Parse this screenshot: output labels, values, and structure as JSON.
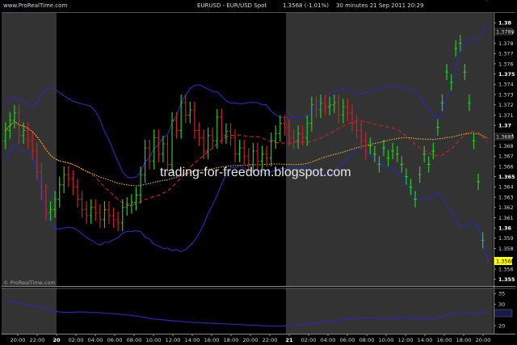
{
  "header": {
    "brand": "www.ProRealTime.com",
    "instrument": "EURUSD - EUR/USD Spot",
    "last_change": "1.3568 (-1.01%)",
    "period": "30 minutes  21 Sep 2011 20:29"
  },
  "watermark": "trading-for-freedom.blogspot.com",
  "footer_brand": "© ProRealTime.com",
  "colors": {
    "background": "#000000",
    "session_shade": "#333333",
    "up_candle": "#22cc22",
    "down_candle": "#cc2222",
    "bollinger": "#2828b4",
    "sma_dashed": "#cc2222",
    "sma_dotted": "#e8c020",
    "indicator": "#2828b4",
    "price_box": "#ffff00"
  },
  "chart_data": [
    {
      "type": "candlestick",
      "title": "EURUSD - EUR/USD Spot",
      "x_ticks": [
        "20:00",
        "22:00",
        "20",
        "02:00",
        "04:00",
        "06:00",
        "08:00",
        "10:00",
        "12:00",
        "14:00",
        "16:00",
        "18:00",
        "20:00",
        "22:00",
        "21",
        "02:00",
        "04:00",
        "06:00",
        "08:00",
        "10:00",
        "12:00",
        "14:00",
        "16:00",
        "18:00",
        "20:00"
      ],
      "bold_ticks": [
        "20",
        "21"
      ],
      "y_ticks": [
        "1.38",
        "1.379",
        "1.378",
        "1.377",
        "1.376",
        "1.375",
        "1.374",
        "1.373",
        "1.372",
        "1.371",
        "1.37",
        "1.369",
        "1.368",
        "1.367",
        "1.366",
        "1.365",
        "1.364",
        "1.363",
        "1.362",
        "1.361",
        "1.36",
        "1.359",
        "1.358",
        "1.357",
        "1.356",
        "1.355"
      ],
      "bold_y_ticks": [
        "1.38",
        "1.375",
        "1.37",
        "1.365",
        "1.36",
        "1.355"
      ],
      "ylim": [
        1.3545,
        1.3808
      ],
      "last_price": "1.3568",
      "sma_value": "1.3685",
      "bb_upper_value": "1.3789",
      "close": [
        1.3695,
        1.3705,
        1.3712,
        1.369,
        1.3695,
        1.3685,
        1.3675,
        1.3655,
        1.3635,
        1.3615,
        1.3618,
        1.3628,
        1.3642,
        1.3652,
        1.3648,
        1.364,
        1.3628,
        1.3618,
        1.3612,
        1.362,
        1.3615,
        1.3608,
        1.3618,
        1.3612,
        1.3608,
        1.3605,
        1.362,
        1.3622,
        1.3625,
        1.3632,
        1.3652,
        1.3678,
        1.3665,
        1.3688,
        1.3672,
        1.3682,
        1.3662,
        1.3705,
        1.3695,
        1.3722,
        1.371,
        1.3715,
        1.3695,
        1.3688,
        1.3675,
        1.369,
        1.3685,
        1.3708,
        1.369,
        1.3694,
        1.3688,
        1.3672,
        1.3678,
        1.367,
        1.3662,
        1.3675,
        1.3665,
        1.3672,
        1.3668,
        1.3685,
        1.3692,
        1.3702,
        1.3698,
        1.3688,
        1.3685,
        1.3692,
        1.3688,
        1.3702,
        1.372,
        1.3715,
        1.3722,
        1.3718,
        1.372,
        1.3722,
        1.371,
        1.3718,
        1.3712,
        1.3702,
        1.3695,
        1.3685,
        1.3675,
        1.368,
        1.3672,
        1.3662,
        1.3678,
        1.3668,
        1.3675,
        1.3672,
        1.3662,
        1.365,
        1.364,
        1.3628,
        1.3652,
        1.3672,
        1.3662,
        1.3675,
        1.3698,
        1.3722,
        1.3752,
        1.3742,
        1.3775,
        1.378,
        1.3752,
        1.3722,
        1.3685,
        1.3645,
        1.3588,
        1.3568
      ],
      "open": [
        1.3685,
        1.3695,
        1.3705,
        1.3712,
        1.369,
        1.3695,
        1.3685,
        1.3675,
        1.3655,
        1.3635,
        1.3615,
        1.3618,
        1.3628,
        1.3642,
        1.3652,
        1.3648,
        1.364,
        1.3628,
        1.3618,
        1.3612,
        1.362,
        1.3615,
        1.3608,
        1.3618,
        1.3612,
        1.3608,
        1.3605,
        1.362,
        1.3622,
        1.3625,
        1.3632,
        1.3652,
        1.3678,
        1.3665,
        1.3688,
        1.3672,
        1.3682,
        1.3662,
        1.3705,
        1.3695,
        1.3722,
        1.371,
        1.3715,
        1.3695,
        1.3688,
        1.3675,
        1.369,
        1.3685,
        1.3708,
        1.369,
        1.3694,
        1.3688,
        1.3672,
        1.3678,
        1.367,
        1.3662,
        1.3675,
        1.3665,
        1.3672,
        1.3668,
        1.3685,
        1.3692,
        1.3702,
        1.3698,
        1.3688,
        1.3685,
        1.3692,
        1.3688,
        1.3702,
        1.372,
        1.3715,
        1.3722,
        1.3718,
        1.372,
        1.3722,
        1.371,
        1.3718,
        1.3712,
        1.3702,
        1.3695,
        1.3685,
        1.368,
        1.3672,
        1.3662,
        1.3678,
        1.3668,
        1.3675,
        1.3672,
        1.3662,
        1.365,
        1.364,
        1.3628,
        1.3652,
        1.3672,
        1.3662,
        1.3675,
        1.3698,
        1.3722,
        1.3752,
        1.3742,
        1.3775,
        1.378,
        1.3752,
        1.3722,
        1.3685,
        1.3645,
        1.3588
      ]
    },
    {
      "type": "line",
      "title": "",
      "y_ticks": [
        "35",
        "30",
        "25",
        "20"
      ],
      "ylim": [
        17,
        37
      ],
      "last_value": "",
      "values": [
        32,
        31.5,
        31,
        30.5,
        30,
        29.6,
        29.2,
        28.8,
        28.4,
        27.8,
        27.2,
        26.8,
        26.4,
        26.2,
        26.2,
        26.3,
        26.4,
        26.4,
        26.3,
        26.2,
        26.1,
        26,
        25.8,
        25.7,
        25.6,
        25.4,
        25.2,
        25,
        24.8,
        24.5,
        24.2,
        23.8,
        23.4,
        23.1,
        22.9,
        22.7,
        22.5,
        22.3,
        22.2,
        22,
        21.8,
        21.6,
        21.5,
        21.4,
        21.3,
        21.2,
        21.1,
        21,
        20.9,
        20.8,
        20.7,
        20.6,
        20.5,
        20.4,
        20.3,
        20.2,
        20.1,
        20,
        19.9,
        19.8,
        19.8,
        19.8,
        19.8,
        19.9,
        20,
        20.2,
        20.5,
        20.8,
        21,
        21.2,
        21.5,
        21.8,
        22,
        22.3,
        22.5,
        22.8,
        23,
        23.2,
        23.4,
        23.6,
        23.6,
        23.6,
        23.5,
        23.4,
        23.3,
        23.2,
        23.2,
        23.4,
        23.6,
        23.8,
        23.8,
        23.6,
        23.4,
        23.2,
        23.2,
        23.4,
        23.8,
        24.3,
        24.8,
        25.4,
        26,
        26.4,
        26.4,
        26,
        25.6,
        25.5,
        26.2,
        27
      ]
    }
  ]
}
